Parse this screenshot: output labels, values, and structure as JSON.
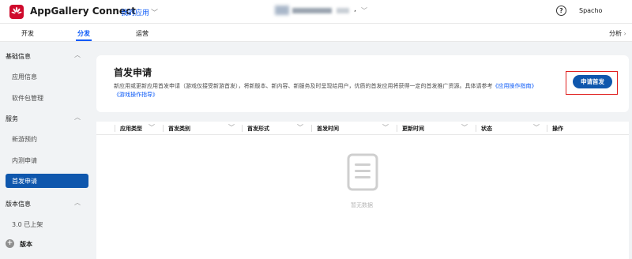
{
  "header": {
    "app_title": "AppGallery Connect",
    "my_apps": "我的应用",
    "project_suffix": ",",
    "username": "Spacho",
    "help_symbol": "?"
  },
  "tabs": [
    {
      "label": "开发",
      "active": false
    },
    {
      "label": "分发",
      "active": true
    },
    {
      "label": "运营",
      "active": false
    }
  ],
  "analysis_label": "分析",
  "sidebar": {
    "sections": [
      {
        "label": "基础信息",
        "items": [
          "应用信息",
          "软件包管理"
        ]
      },
      {
        "label": "服务",
        "items": [
          "新游预约",
          "内测申请",
          "首发申请"
        ]
      },
      {
        "label": "版本信息",
        "items": [
          "3.0 已上架"
        ]
      }
    ],
    "active_item": "首发申请",
    "version_label": "版本"
  },
  "card": {
    "title": "首发申请",
    "description": "新应用或更新应用首发申请（游戏仅接受新游首发），将新版本、新内容、新服务及时呈现给用户，优质的首发应用将获得一定的首发推广资源。具体请参考",
    "link1": "《应用操作指南》",
    "link2": "《游戏操作指导》",
    "button_label": "申请首发"
  },
  "table": {
    "columns": [
      "应用类型",
      "首发类别",
      "首发形式",
      "首发时间",
      "更新时间",
      "状态",
      "操作"
    ],
    "empty_text": "暂无数据"
  },
  "colors": {
    "brand_red": "#cf0a2c",
    "primary_blue": "#0f57ad",
    "link_blue": "#0a59f7",
    "highlight_red": "#e0201f"
  }
}
